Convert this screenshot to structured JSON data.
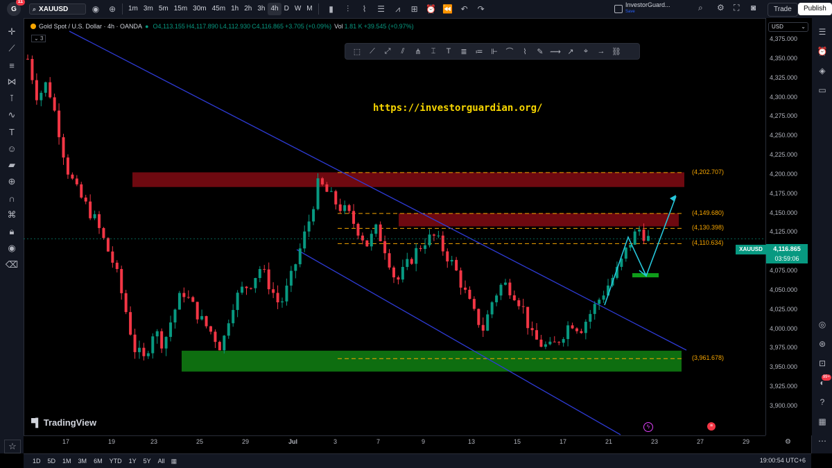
{
  "topbar": {
    "logo_label": "G",
    "logo_badge": "11",
    "symbol": "XAUUSD",
    "timeframes": [
      "1m",
      "3m",
      "5m",
      "15m",
      "30m",
      "45m",
      "1h",
      "2h",
      "3h",
      "4h",
      "D",
      "W",
      "M"
    ],
    "active_timeframe": "4h",
    "account_name": "InvestorGuard...",
    "account_status": "Save",
    "trade_label": "Trade",
    "publish_label": "Publish"
  },
  "legend": {
    "title": "Gold Spot / U.S. Dollar · 4h · OANDA",
    "open": "O4,113.155",
    "high": "H4,117.890",
    "low": "L4,112.930",
    "close": "C4,116.865",
    "change": "+3.705 (+0.09%)",
    "volume_label": "Vol",
    "volume_value": "1.81 K",
    "volume_change": "+39.545 (+0.97%)",
    "indicator_count": "3"
  },
  "watermark_url": "https://investorguardian.org/",
  "brand": "TradingView",
  "price_axis": {
    "currency": "USD",
    "ticks": [
      "4,375.000",
      "4,350.000",
      "4,325.000",
      "4,300.000",
      "4,275.000",
      "4,250.000",
      "4,225.000",
      "4,200.000",
      "4,175.000",
      "4,150.000",
      "4,125.000",
      "4,100.000",
      "4,075.000",
      "4,050.000",
      "4,025.000",
      "4,000.000",
      "3,975.000",
      "3,950.000",
      "3,925.000",
      "3,900.000"
    ],
    "current_symbol": "XAUUSD",
    "current_price": "4,116.865",
    "countdown": "03:59:06"
  },
  "time_axis": {
    "ticks": [
      "17",
      "19",
      "23",
      "25",
      "29",
      "Jul",
      "3",
      "7",
      "9",
      "13",
      "15",
      "17",
      "21",
      "23",
      "27",
      "29"
    ]
  },
  "levels": [
    {
      "label": "(4,202.707)",
      "price": 4202.707
    },
    {
      "label": "(4,149.680)",
      "price": 4149.68
    },
    {
      "label": "(4,130.398)",
      "price": 4130.398
    },
    {
      "label": "(4,110.634)",
      "price": 4110.634
    },
    {
      "label": "(3,961.678)",
      "price": 3961.678
    }
  ],
  "bottom": {
    "ranges": [
      "1D",
      "5D",
      "1M",
      "3M",
      "6M",
      "YTD",
      "1Y",
      "5Y",
      "All"
    ],
    "clock": "19:00:54 UTC+6"
  },
  "colors": {
    "bull": "#089981",
    "bear": "#f23645",
    "resistance_zone": "#7a0a12",
    "support_zone": "#0f7a12",
    "trendline": "#2e3bd6",
    "projection": "#26c6da",
    "level_line": "#f7a600",
    "url_text": "#f7d600"
  },
  "chart_data": {
    "type": "candlestick",
    "symbol": "XAUUSD",
    "timeframe": "4h",
    "ylim": [
      3890,
      4385
    ],
    "zones": [
      {
        "kind": "resistance",
        "from": 4184,
        "to": 4203
      },
      {
        "kind": "resistance",
        "from": 4133,
        "to": 4150
      },
      {
        "kind": "support",
        "from": 3945,
        "to": 3972
      }
    ],
    "trend_points": [
      4350,
      4300,
      4320,
      4270,
      4210,
      4180,
      4160,
      4140,
      4110,
      4080,
      4030,
      3975,
      3960,
      4000,
      3980,
      4020,
      4050,
      4030,
      4010,
      3995,
      3975,
      4030,
      4050,
      4060,
      4080,
      4055,
      4030,
      4060,
      4100,
      4140,
      4190,
      4175,
      4160,
      4150,
      4130,
      4110,
      4130,
      4100,
      4060,
      4080,
      4100,
      4115,
      4120,
      4100,
      4080,
      4050,
      4020,
      4000,
      4040,
      4060,
      4050,
      4030,
      3990,
      3980,
      3975,
      3990,
      4010,
      4000,
      4020,
      4040,
      4060,
      4080,
      4110,
      4130,
      4117
    ]
  }
}
